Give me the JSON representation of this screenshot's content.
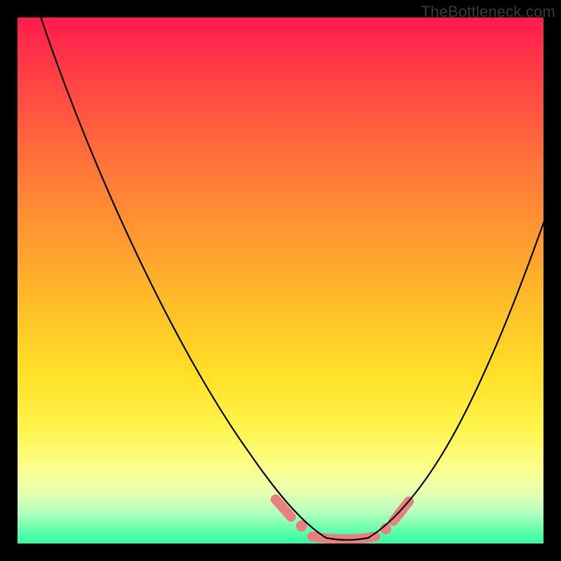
{
  "watermark": "TheBottleneck.com",
  "chart_data": {
    "type": "line",
    "title": "",
    "xlabel": "",
    "ylabel": "",
    "xlim": [
      0,
      100
    ],
    "ylim": [
      0,
      100
    ],
    "grid": false,
    "legend": false,
    "gradient_stops": [
      {
        "pos": 0,
        "color": "#ff1a4d"
      },
      {
        "pos": 7,
        "color": "#ff3348"
      },
      {
        "pos": 18,
        "color": "#ff5540"
      },
      {
        "pos": 30,
        "color": "#ff7a38"
      },
      {
        "pos": 42,
        "color": "#ff9a30"
      },
      {
        "pos": 55,
        "color": "#ffbf28"
      },
      {
        "pos": 68,
        "color": "#ffe028"
      },
      {
        "pos": 78,
        "color": "#fff44a"
      },
      {
        "pos": 85,
        "color": "#fcff87"
      },
      {
        "pos": 90,
        "color": "#e9ffb0"
      },
      {
        "pos": 94,
        "color": "#b8ffbf"
      },
      {
        "pos": 97,
        "color": "#6fffb0"
      },
      {
        "pos": 100,
        "color": "#2effa0"
      }
    ],
    "series": [
      {
        "name": "left-branch",
        "color": "#000000",
        "points": [
          {
            "x": 4,
            "y": 100
          },
          {
            "x": 10,
            "y": 85
          },
          {
            "x": 18,
            "y": 68
          },
          {
            "x": 26,
            "y": 52
          },
          {
            "x": 34,
            "y": 36
          },
          {
            "x": 40,
            "y": 24
          },
          {
            "x": 46,
            "y": 12
          },
          {
            "x": 50,
            "y": 6
          },
          {
            "x": 54,
            "y": 2
          },
          {
            "x": 58,
            "y": 0.5
          }
        ]
      },
      {
        "name": "valley-floor",
        "color": "#000000",
        "points": [
          {
            "x": 58,
            "y": 0.5
          },
          {
            "x": 62,
            "y": 0.3
          },
          {
            "x": 66,
            "y": 0.5
          }
        ]
      },
      {
        "name": "right-branch",
        "color": "#000000",
        "points": [
          {
            "x": 66,
            "y": 0.5
          },
          {
            "x": 71,
            "y": 3
          },
          {
            "x": 77,
            "y": 10
          },
          {
            "x": 84,
            "y": 22
          },
          {
            "x": 90,
            "y": 36
          },
          {
            "x": 96,
            "y": 52
          },
          {
            "x": 100,
            "y": 64
          }
        ]
      },
      {
        "name": "salmon-highlight",
        "color": "#e98080",
        "points": [
          {
            "x": 49,
            "y": 8
          },
          {
            "x": 52,
            "y": 4.5
          },
          {
            "x": 55,
            "y": 2
          },
          {
            "x": 58,
            "y": 0.6
          },
          {
            "x": 62,
            "y": 0.4
          },
          {
            "x": 66,
            "y": 0.6
          },
          {
            "x": 69,
            "y": 2
          },
          {
            "x": 72,
            "y": 5
          },
          {
            "x": 74,
            "y": 8
          }
        ]
      }
    ]
  }
}
